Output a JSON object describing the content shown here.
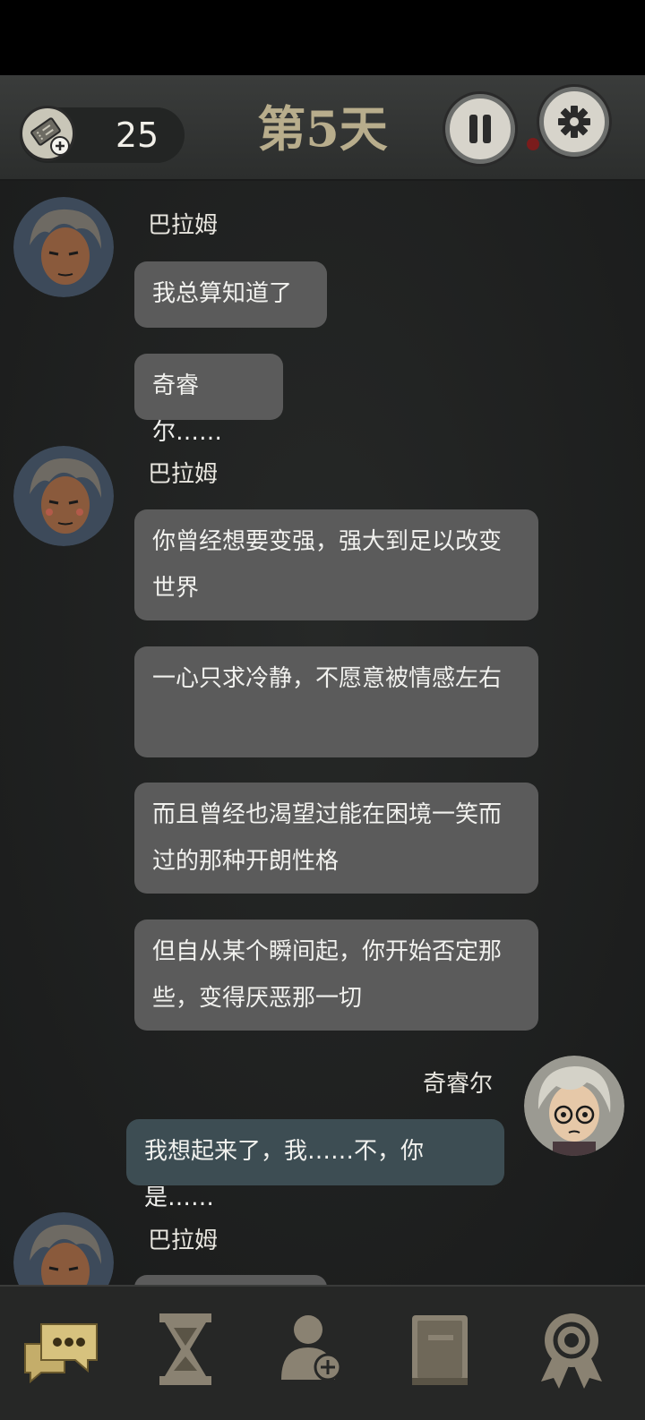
{
  "header": {
    "ticket_count": "25",
    "day_title": "第5天",
    "icons": {
      "ticket": "ticket-plus-icon",
      "pause": "pause-icon",
      "settings": "gear-icon"
    }
  },
  "chat": {
    "messages": [
      {
        "sender": "巴拉姆",
        "side": "left",
        "bubbles": [
          "我总算知道了",
          "奇睿尔……"
        ]
      },
      {
        "sender": "巴拉姆",
        "side": "left",
        "bubbles": [
          "你曾经想要变强，强大到足以改变世界",
          "一心只求冷静，不愿意被情感左右",
          "而且曾经也渴望过能在困境一笑而过的那种开朗性格",
          "但自从某个瞬间起，你开始否定那些，变得厌恶那一切"
        ]
      },
      {
        "sender": "奇睿尔",
        "side": "right",
        "bubbles": [
          "我想起来了，我……不，你是……"
        ]
      },
      {
        "sender": "巴拉姆",
        "side": "left",
        "bubbles": [
          ""
        ]
      }
    ]
  },
  "tabbar": {
    "tabs": [
      {
        "icon": "chat-bubbles-icon",
        "active": true
      },
      {
        "icon": "hourglass-icon",
        "active": false
      },
      {
        "icon": "add-contact-icon",
        "active": false
      },
      {
        "icon": "book-icon",
        "active": false
      },
      {
        "icon": "achievement-medal-icon",
        "active": false
      }
    ]
  },
  "colors": {
    "active_tab": "#d7c27e",
    "inactive_tab": "#8a8272",
    "bubble_other": "#5b5b5b",
    "bubble_self": "#3d4d53",
    "day_title": "#b8ad8c"
  }
}
